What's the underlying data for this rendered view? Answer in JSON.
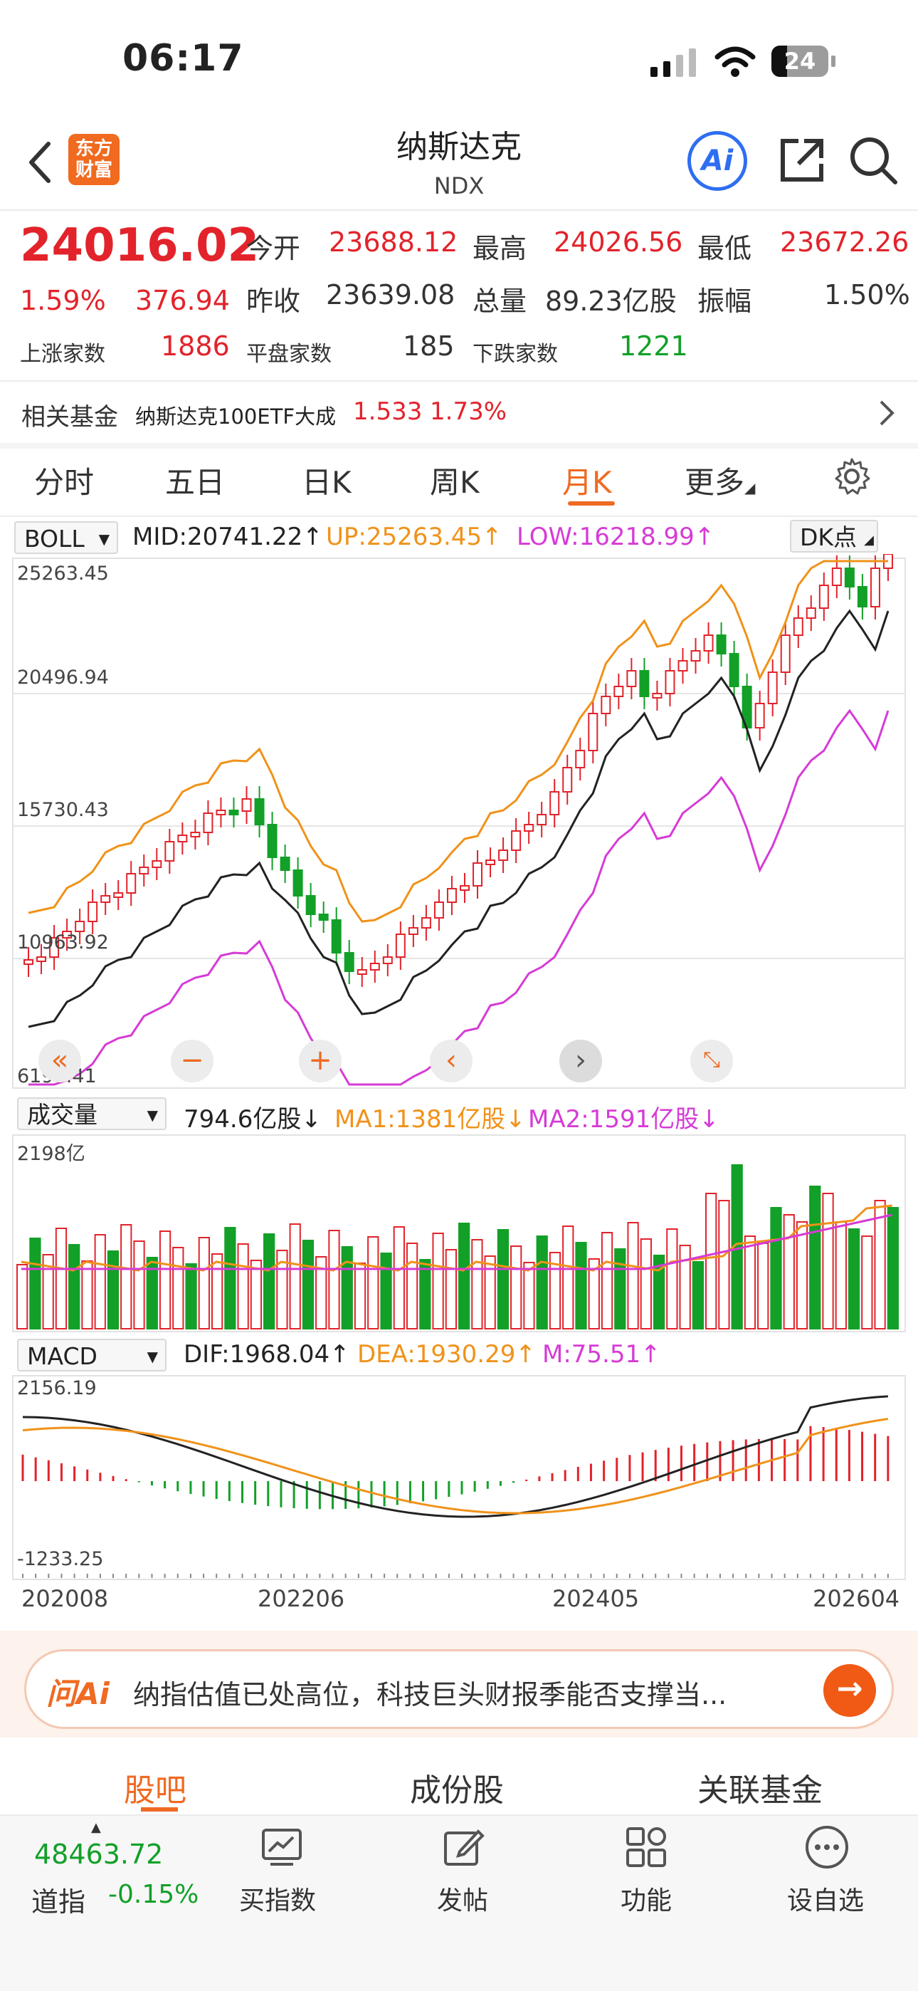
{
  "status_bar": {
    "time": "06:17",
    "battery": "24"
  },
  "header": {
    "logo_line1": "东方",
    "logo_line2": "财富",
    "title": "纳斯达克",
    "subtitle": "NDX",
    "ai_label": "Ai"
  },
  "quote": {
    "price": "24016.02",
    "change_pct": "1.59%",
    "change": "376.94",
    "open_label": "今开",
    "open": "23688.12",
    "high_label": "最高",
    "high": "24026.56",
    "low_label": "最低",
    "low": "23672.26",
    "prev_label": "昨收",
    "prev": "23639.08",
    "vol_label": "总量",
    "vol": "89.23亿股",
    "amp_label": "振幅",
    "amp": "1.50%",
    "up_label": "上涨家数",
    "up": "1886",
    "flat_label": "平盘家数",
    "flat": "185",
    "down_label": "下跌家数",
    "down": "1221"
  },
  "fund": {
    "label": "相关基金",
    "name": "纳斯达克100ETF大成",
    "price": "1.533",
    "pct": "1.73%"
  },
  "tabs": [
    "分时",
    "五日",
    "日K",
    "周K",
    "月K",
    "更多"
  ],
  "boll": {
    "selector": "BOLL",
    "mid": "MID:20741.22↑",
    "up": "UP:25263.45↑",
    "low": "LOW:16218.99↑",
    "dk": "DK点"
  },
  "price_axis": [
    "25263.45",
    "20496.94",
    "15730.43",
    "10963.92",
    "6197.41"
  ],
  "volume": {
    "selector": "成交量",
    "value": "794.6亿股↓",
    "ma1": "MA1:1381亿股↓",
    "ma2": "MA2:1591亿股↓",
    "top": "2198亿"
  },
  "macd": {
    "selector": "MACD",
    "dif": "DIF:1968.04↑",
    "dea": "DEA:1930.29↑",
    "m": "M:75.51↑",
    "top": "2156.19",
    "bottom": "-1233.25"
  },
  "dates": [
    "202008",
    "202206",
    "202405",
    "202604"
  ],
  "ai_bar": {
    "logo": "问Ai",
    "text": "纳指估值已处高位，科技巨头财报季能否支撑当..."
  },
  "bottom_tabs": [
    "股吧",
    "成份股",
    "关联基金"
  ],
  "bottom_nav": {
    "dow_value": "48463.72",
    "dow_label": "道指",
    "dow_pct": "-0.15%",
    "items": [
      "买指数",
      "发帖",
      "功能",
      "设自选"
    ]
  },
  "colors": {
    "up": "#e2232b",
    "down": "#12a028",
    "accent": "#ef6a22",
    "mid": "#222222",
    "upper": "#f0921a",
    "lower": "#d63bd6"
  },
  "chart_data": {
    "type": "candlestick",
    "period": "monthly",
    "x_ticks": [
      "202008",
      "202206",
      "202405",
      "202604"
    ],
    "y_ticks": [
      25263.45,
      20496.94,
      15730.43,
      10963.92,
      6197.41
    ],
    "ylim": [
      6197.41,
      25263.45
    ],
    "indicators": {
      "BOLL_MID": 20741.22,
      "BOLL_UP": 25263.45,
      "BOLL_LOW": 16218.99,
      "MACD_DIF": 1968.04,
      "MACD_DEA": 1930.29,
      "MACD_M": 75.51,
      "VOL": "794.6亿股",
      "VOL_MA1": "1381亿股",
      "VOL_MA2": "1591亿股"
    }
  }
}
